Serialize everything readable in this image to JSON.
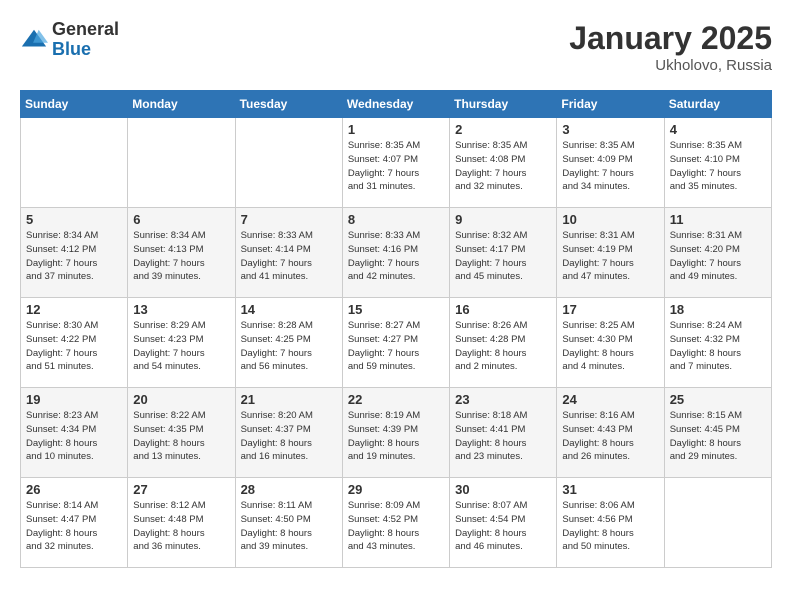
{
  "logo": {
    "general": "General",
    "blue": "Blue"
  },
  "title": "January 2025",
  "subtitle": "Ukholovo, Russia",
  "days_header": [
    "Sunday",
    "Monday",
    "Tuesday",
    "Wednesday",
    "Thursday",
    "Friday",
    "Saturday"
  ],
  "weeks": [
    [
      {
        "day": "",
        "info": ""
      },
      {
        "day": "",
        "info": ""
      },
      {
        "day": "",
        "info": ""
      },
      {
        "day": "1",
        "info": "Sunrise: 8:35 AM\nSunset: 4:07 PM\nDaylight: 7 hours\nand 31 minutes."
      },
      {
        "day": "2",
        "info": "Sunrise: 8:35 AM\nSunset: 4:08 PM\nDaylight: 7 hours\nand 32 minutes."
      },
      {
        "day": "3",
        "info": "Sunrise: 8:35 AM\nSunset: 4:09 PM\nDaylight: 7 hours\nand 34 minutes."
      },
      {
        "day": "4",
        "info": "Sunrise: 8:35 AM\nSunset: 4:10 PM\nDaylight: 7 hours\nand 35 minutes."
      }
    ],
    [
      {
        "day": "5",
        "info": "Sunrise: 8:34 AM\nSunset: 4:12 PM\nDaylight: 7 hours\nand 37 minutes."
      },
      {
        "day": "6",
        "info": "Sunrise: 8:34 AM\nSunset: 4:13 PM\nDaylight: 7 hours\nand 39 minutes."
      },
      {
        "day": "7",
        "info": "Sunrise: 8:33 AM\nSunset: 4:14 PM\nDaylight: 7 hours\nand 41 minutes."
      },
      {
        "day": "8",
        "info": "Sunrise: 8:33 AM\nSunset: 4:16 PM\nDaylight: 7 hours\nand 42 minutes."
      },
      {
        "day": "9",
        "info": "Sunrise: 8:32 AM\nSunset: 4:17 PM\nDaylight: 7 hours\nand 45 minutes."
      },
      {
        "day": "10",
        "info": "Sunrise: 8:31 AM\nSunset: 4:19 PM\nDaylight: 7 hours\nand 47 minutes."
      },
      {
        "day": "11",
        "info": "Sunrise: 8:31 AM\nSunset: 4:20 PM\nDaylight: 7 hours\nand 49 minutes."
      }
    ],
    [
      {
        "day": "12",
        "info": "Sunrise: 8:30 AM\nSunset: 4:22 PM\nDaylight: 7 hours\nand 51 minutes."
      },
      {
        "day": "13",
        "info": "Sunrise: 8:29 AM\nSunset: 4:23 PM\nDaylight: 7 hours\nand 54 minutes."
      },
      {
        "day": "14",
        "info": "Sunrise: 8:28 AM\nSunset: 4:25 PM\nDaylight: 7 hours\nand 56 minutes."
      },
      {
        "day": "15",
        "info": "Sunrise: 8:27 AM\nSunset: 4:27 PM\nDaylight: 7 hours\nand 59 minutes."
      },
      {
        "day": "16",
        "info": "Sunrise: 8:26 AM\nSunset: 4:28 PM\nDaylight: 8 hours\nand 2 minutes."
      },
      {
        "day": "17",
        "info": "Sunrise: 8:25 AM\nSunset: 4:30 PM\nDaylight: 8 hours\nand 4 minutes."
      },
      {
        "day": "18",
        "info": "Sunrise: 8:24 AM\nSunset: 4:32 PM\nDaylight: 8 hours\nand 7 minutes."
      }
    ],
    [
      {
        "day": "19",
        "info": "Sunrise: 8:23 AM\nSunset: 4:34 PM\nDaylight: 8 hours\nand 10 minutes."
      },
      {
        "day": "20",
        "info": "Sunrise: 8:22 AM\nSunset: 4:35 PM\nDaylight: 8 hours\nand 13 minutes."
      },
      {
        "day": "21",
        "info": "Sunrise: 8:20 AM\nSunset: 4:37 PM\nDaylight: 8 hours\nand 16 minutes."
      },
      {
        "day": "22",
        "info": "Sunrise: 8:19 AM\nSunset: 4:39 PM\nDaylight: 8 hours\nand 19 minutes."
      },
      {
        "day": "23",
        "info": "Sunrise: 8:18 AM\nSunset: 4:41 PM\nDaylight: 8 hours\nand 23 minutes."
      },
      {
        "day": "24",
        "info": "Sunrise: 8:16 AM\nSunset: 4:43 PM\nDaylight: 8 hours\nand 26 minutes."
      },
      {
        "day": "25",
        "info": "Sunrise: 8:15 AM\nSunset: 4:45 PM\nDaylight: 8 hours\nand 29 minutes."
      }
    ],
    [
      {
        "day": "26",
        "info": "Sunrise: 8:14 AM\nSunset: 4:47 PM\nDaylight: 8 hours\nand 32 minutes."
      },
      {
        "day": "27",
        "info": "Sunrise: 8:12 AM\nSunset: 4:48 PM\nDaylight: 8 hours\nand 36 minutes."
      },
      {
        "day": "28",
        "info": "Sunrise: 8:11 AM\nSunset: 4:50 PM\nDaylight: 8 hours\nand 39 minutes."
      },
      {
        "day": "29",
        "info": "Sunrise: 8:09 AM\nSunset: 4:52 PM\nDaylight: 8 hours\nand 43 minutes."
      },
      {
        "day": "30",
        "info": "Sunrise: 8:07 AM\nSunset: 4:54 PM\nDaylight: 8 hours\nand 46 minutes."
      },
      {
        "day": "31",
        "info": "Sunrise: 8:06 AM\nSunset: 4:56 PM\nDaylight: 8 hours\nand 50 minutes."
      },
      {
        "day": "",
        "info": ""
      }
    ]
  ]
}
